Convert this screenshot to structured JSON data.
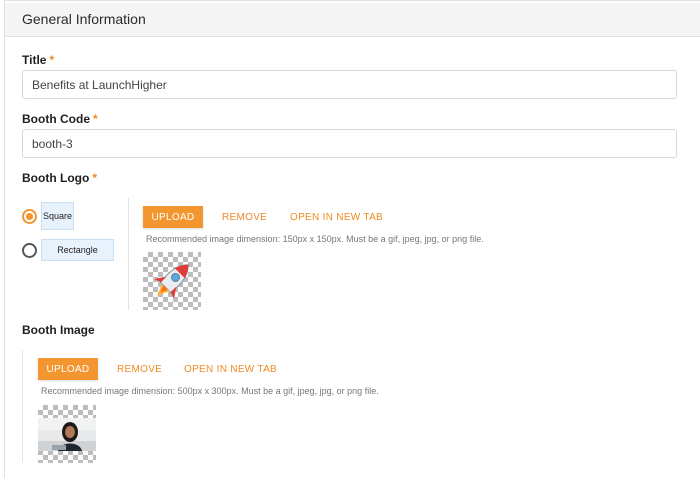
{
  "section": {
    "title": "General Information"
  },
  "fields": {
    "title": {
      "label": "Title",
      "required_mark": "*",
      "value": "Benefits at LaunchHigher"
    },
    "booth_code": {
      "label": "Booth Code",
      "required_mark": "*",
      "value": "booth-3"
    },
    "booth_logo": {
      "label": "Booth Logo",
      "required_mark": "*",
      "shape_options": [
        {
          "label": "Square",
          "selected": true
        },
        {
          "label": "Rectangle",
          "selected": false
        }
      ],
      "upload_label": "UPLOAD",
      "remove_label": "REMOVE",
      "open_label": "OPEN IN NEW TAB",
      "hint": "Recommended image dimension: 150px x 150px. Must be a gif, jpeg, jpg, or png file.",
      "preview_icon": "rocket-icon"
    },
    "booth_image": {
      "label": "Booth Image",
      "upload_label": "UPLOAD",
      "remove_label": "REMOVE",
      "open_label": "OPEN IN NEW TAB",
      "hint": "Recommended image dimension: 500px x 300px. Must be a gif, jpeg, jpg, or png file.",
      "preview_icon": "person-photo"
    }
  },
  "colors": {
    "accent": "#f3962f",
    "accent_text": "#f08a24",
    "chip_bg": "#e8f2fc"
  }
}
